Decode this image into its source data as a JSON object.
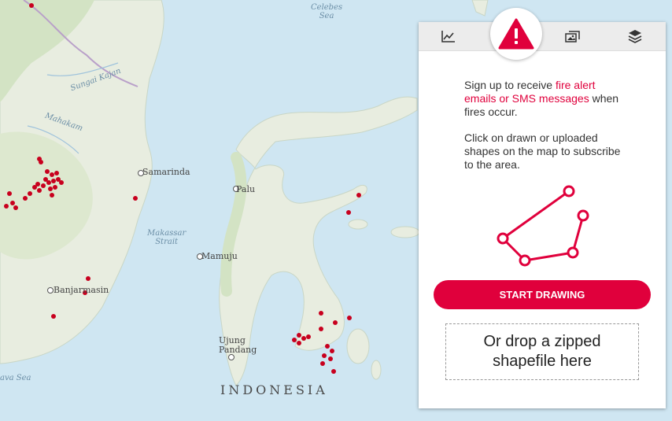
{
  "map": {
    "country_label": "INDONESIA",
    "seas": [
      {
        "id": "celebes",
        "text": "Celebes\nSea"
      },
      {
        "id": "makassar",
        "text": "Makassar\nStrait"
      },
      {
        "id": "java",
        "text": "ava Sea"
      }
    ],
    "rivers": [
      {
        "id": "kajan",
        "text": "Sungai Kajan"
      },
      {
        "id": "mahakam",
        "text": "Mahakam"
      }
    ],
    "cities": [
      {
        "id": "samarinda",
        "name": "Samarinda"
      },
      {
        "id": "palu",
        "name": "Palu"
      },
      {
        "id": "mamuju",
        "name": "Mamuju"
      },
      {
        "id": "banjarmasin",
        "name": "Banjarmasin"
      },
      {
        "id": "ujung-pandang",
        "name": "Ujung\nPandang"
      }
    ],
    "fire_color": "#c8001e"
  },
  "panel": {
    "tabs": [
      {
        "id": "analysis",
        "icon": "line-chart-icon",
        "active": false
      },
      {
        "id": "subscribe",
        "icon": "alert-icon",
        "active": true
      },
      {
        "id": "imagery",
        "icon": "imagery-icon",
        "active": false
      },
      {
        "id": "layers",
        "icon": "layers-icon",
        "active": false
      }
    ],
    "intro_before": "Sign up to receive ",
    "intro_link": "fire alert emails or SMS messages",
    "intro_after": " when fires occur.",
    "instructions": "Click on drawn or uploaded shapes on the map to subscribe to the area.",
    "start_button": "START DRAWING",
    "dropzone": "Or drop a zipped shapefile here",
    "accent_color": "#e0003c"
  }
}
